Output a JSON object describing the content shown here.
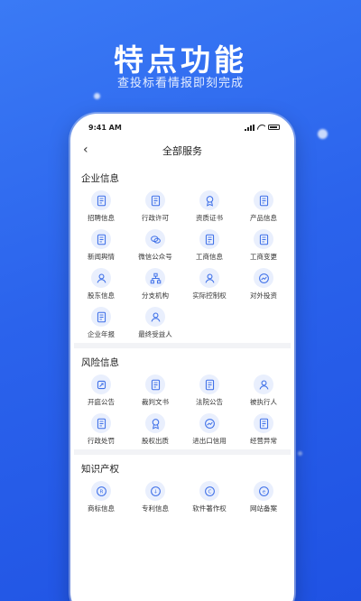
{
  "hero": {
    "title": "特点功能",
    "subtitle": "查投标看情报即刻完成"
  },
  "status": {
    "time": "9:41 AM"
  },
  "nav": {
    "back": "‹",
    "title": "全部服务"
  },
  "sections": [
    {
      "title": "企业信息",
      "items": [
        {
          "label": "招聘信息",
          "icon": "resume-icon"
        },
        {
          "label": "行政许可",
          "icon": "permit-icon"
        },
        {
          "label": "资质证书",
          "icon": "certificate-icon"
        },
        {
          "label": "产品信息",
          "icon": "product-doc-icon"
        },
        {
          "label": "新闻舆情",
          "icon": "news-icon"
        },
        {
          "label": "微信公众号",
          "icon": "wechat-icon"
        },
        {
          "label": "工商信息",
          "icon": "business-info-icon"
        },
        {
          "label": "工商变更",
          "icon": "business-change-icon"
        },
        {
          "label": "股东信息",
          "icon": "shareholder-icon"
        },
        {
          "label": "分支机构",
          "icon": "branch-icon"
        },
        {
          "label": "实际控制权",
          "icon": "controller-icon"
        },
        {
          "label": "对外投资",
          "icon": "investment-icon"
        },
        {
          "label": "企业年报",
          "icon": "annual-report-icon"
        },
        {
          "label": "最终受益人",
          "icon": "beneficiary-icon"
        }
      ]
    },
    {
      "title": "风险信息",
      "items": [
        {
          "label": "开庭公告",
          "icon": "court-notice-icon"
        },
        {
          "label": "裁判文书",
          "icon": "judgment-icon"
        },
        {
          "label": "法院公告",
          "icon": "court-announce-icon"
        },
        {
          "label": "被执行人",
          "icon": "executed-person-icon"
        },
        {
          "label": "行政处罚",
          "icon": "penalty-icon"
        },
        {
          "label": "股权出质",
          "icon": "equity-pledge-icon"
        },
        {
          "label": "进出口信用",
          "icon": "import-export-icon"
        },
        {
          "label": "经营异常",
          "icon": "abnormal-icon"
        }
      ]
    },
    {
      "title": "知识产权",
      "items": [
        {
          "label": "商标信息",
          "icon": "trademark-icon"
        },
        {
          "label": "专利信息",
          "icon": "patent-icon"
        },
        {
          "label": "软件著作权",
          "icon": "copyright-icon"
        },
        {
          "label": "网站备案",
          "icon": "website-icon"
        }
      ]
    }
  ],
  "colors": {
    "background": "#2b63ec",
    "icon_bg": "#e9effd",
    "icon_stroke": "#3d6fe8"
  }
}
